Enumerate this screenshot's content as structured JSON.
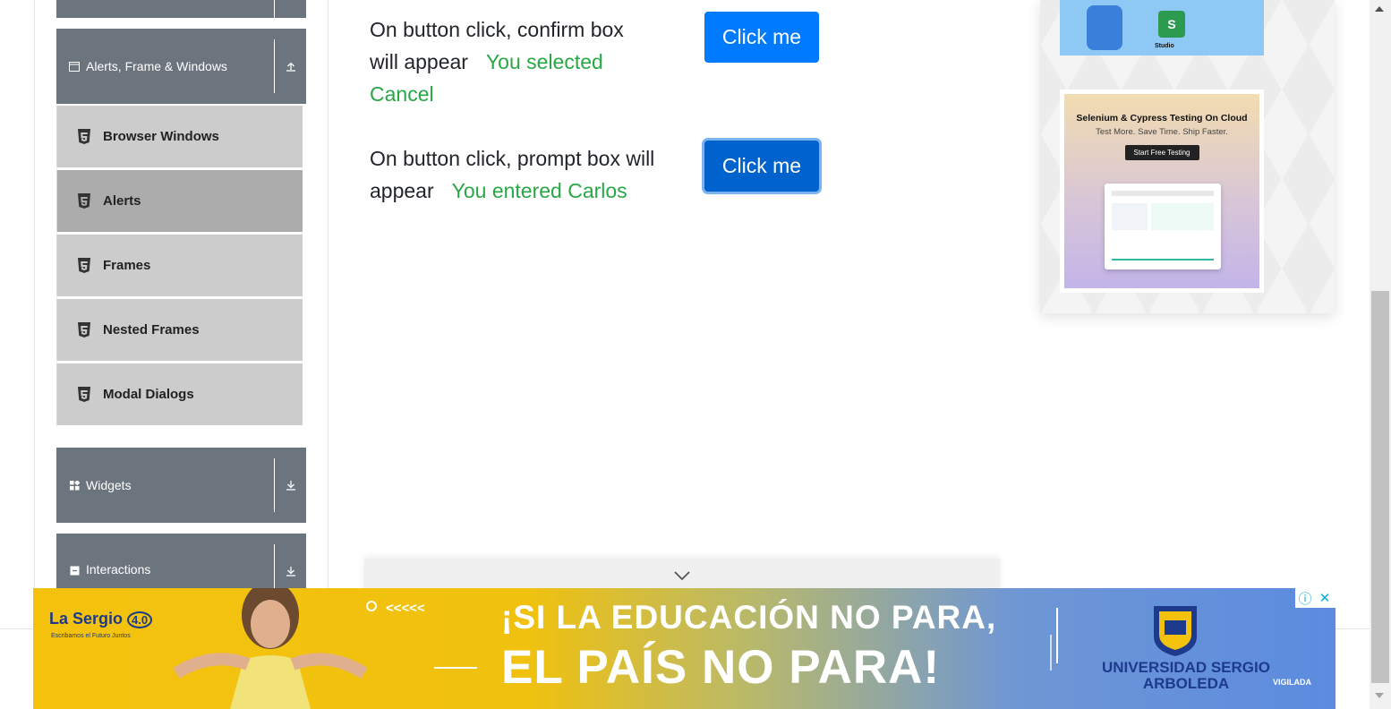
{
  "sidebar": {
    "alerts_group": {
      "label": "Alerts, Frame & Windows",
      "toggle_icon": "arrow-up-icon"
    },
    "items": [
      {
        "label": "Browser Windows",
        "active": false
      },
      {
        "label": "Alerts",
        "active": true
      },
      {
        "label": "Frames",
        "active": false
      },
      {
        "label": "Nested Frames",
        "active": false
      },
      {
        "label": "Modal Dialogs",
        "active": false
      }
    ],
    "widgets_group": {
      "label": "Widgets",
      "toggle_icon": "arrow-down-icon"
    },
    "interactions_group": {
      "label": "Interactions",
      "toggle_icon": "arrow-down-icon"
    }
  },
  "main": {
    "confirm_row": {
      "text": "On button click, confirm box will appear",
      "result": "You selected Cancel",
      "button_label": "Click me"
    },
    "prompt_row": {
      "text": "On button click, prompt box will appear",
      "result": "You entered Carlos",
      "button_label": "Click me"
    }
  },
  "ads": {
    "side_top_label": "Studio",
    "side_card": {
      "title": "Selenium & Cypress Testing On Cloud",
      "subtitle": "Test More. Save Time. Ship Faster.",
      "cta": "Start Free Testing"
    },
    "banner": {
      "logo": "La Sergio",
      "logo_badge": "4.0",
      "logo_tagline": "Escribamos el Futuro Juntos",
      "arrows": "<<<<<",
      "line1": "¡SI LA EDUCACIÓN NO PARA,",
      "line2": "EL PAÍS NO PARA!",
      "university": "UNIVERSIDAD SERGIO ARBOLEDA",
      "vigilada": "VIGILADA"
    }
  },
  "colors": {
    "accent_green": "#28a745",
    "button_blue": "#007bff",
    "sidebar_group": "#6c757d"
  }
}
